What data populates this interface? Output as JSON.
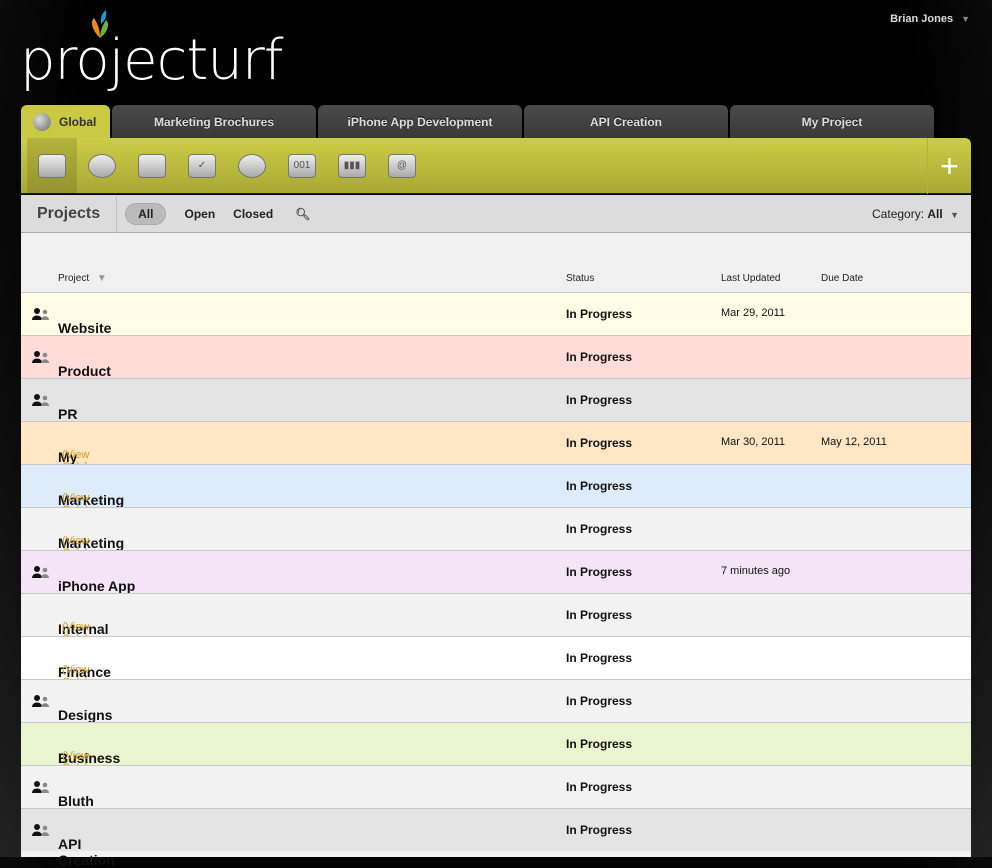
{
  "app": {
    "logo": "projecturf",
    "user": "Brian Jones"
  },
  "tabs": [
    {
      "label": "Global"
    },
    {
      "label": "Marketing Brochures"
    },
    {
      "label": "iPhone App Development"
    },
    {
      "label": "API Creation"
    },
    {
      "label": "My Project"
    }
  ],
  "toolbar": {
    "icons": [
      "briefcase-icon",
      "dashboard-gauge-icon",
      "calendar-icon",
      "tasks-checklist-icon",
      "alarm-clock-icon",
      "tickets-icon",
      "chart-icon",
      "contacts-book-icon"
    ],
    "ticket_text": "001",
    "add_label": "+"
  },
  "filter": {
    "title": "Projects",
    "all": "All",
    "open": "Open",
    "closed": "Closed",
    "category_label": "Category:",
    "category_value": "All"
  },
  "table": {
    "headers": {
      "project": "Project",
      "status": "Status",
      "last_updated": "Last Updated",
      "due_date": "Due Date"
    },
    "rows": [
      {
        "name": "Website",
        "shared": true,
        "view_only": "",
        "status": "In Progress",
        "last_updated": "Mar 29, 2011",
        "due": "",
        "color": "#fffde6"
      },
      {
        "name": "Product Launch Prep",
        "shared": true,
        "view_only": "",
        "status": "In Progress",
        "last_updated": "",
        "due": "",
        "color": "#ffdcd8"
      },
      {
        "name": "PR Campaigns",
        "shared": true,
        "view_only": "",
        "status": "In Progress",
        "last_updated": "",
        "due": "",
        "color": "#e4e4e4"
      },
      {
        "name": "My Project",
        "shared": false,
        "view_only": "(View Only)",
        "status": "In Progress",
        "last_updated": "Mar 30, 2011",
        "due": "May 12, 2011",
        "color": "#ffe7c6"
      },
      {
        "name": "Marketing Plan",
        "shared": false,
        "view_only": "(View Only)",
        "status": "In Progress",
        "last_updated": "",
        "due": "",
        "color": "#deebfa"
      },
      {
        "name": "Marketing Brochures",
        "shared": false,
        "view_only": "(View Only)",
        "status": "In Progress",
        "last_updated": "",
        "due": "",
        "color": "#f2f2f2"
      },
      {
        "name": "iPhone App Development",
        "shared": true,
        "view_only": "",
        "status": "In Progress",
        "last_updated": "7 minutes ago",
        "due": "",
        "color": "#f3e4f6"
      },
      {
        "name": "Internal Policies",
        "shared": false,
        "view_only": "(View Only)",
        "status": "In Progress",
        "last_updated": "",
        "due": "",
        "color": "#f2f2f2"
      },
      {
        "name": "Finance P&L",
        "shared": false,
        "view_only": "(View Only)",
        "status": "In Progress",
        "last_updated": "",
        "due": "",
        "color": "#ffffff"
      },
      {
        "name": "Designs and Sketches",
        "shared": true,
        "view_only": "",
        "status": "In Progress",
        "last_updated": "",
        "due": "",
        "color": "#f2f2f2"
      },
      {
        "name": "Business cards",
        "shared": false,
        "view_only": "(View Only)",
        "status": "In Progress",
        "last_updated": "",
        "due": "",
        "color": "#e9f4d0"
      },
      {
        "name": "Bluth Company",
        "shared": true,
        "view_only": "",
        "status": "In Progress",
        "last_updated": "",
        "due": "",
        "color": "#f2f2f2"
      },
      {
        "name": "API Creation",
        "shared": true,
        "view_only": "",
        "status": "In Progress",
        "last_updated": "",
        "due": "",
        "color": "#e4e4e4"
      }
    ]
  }
}
